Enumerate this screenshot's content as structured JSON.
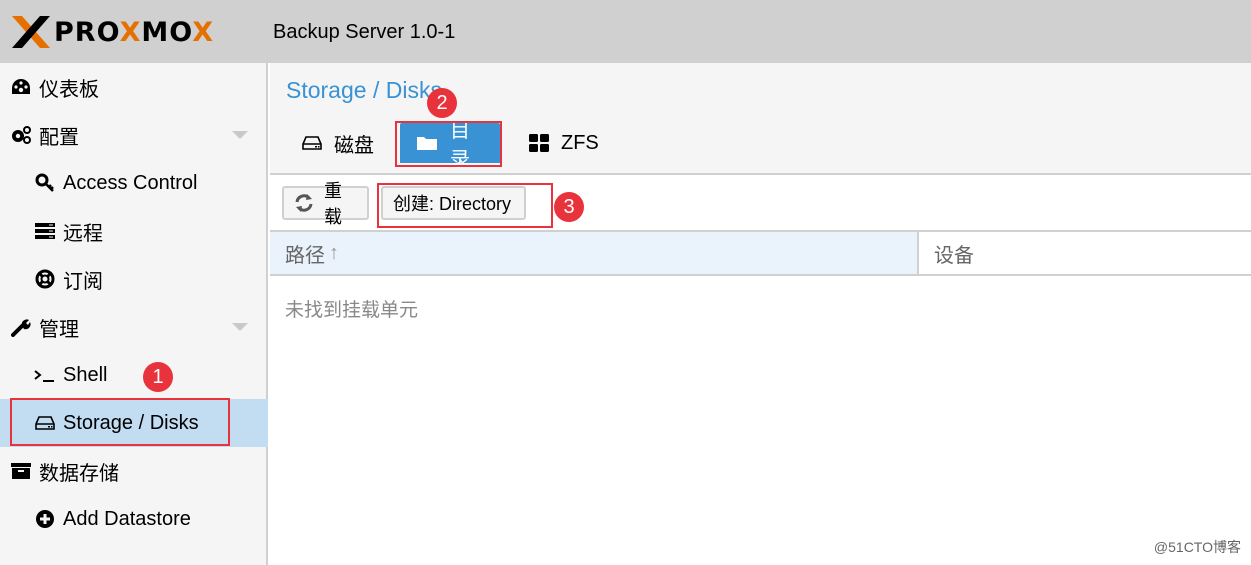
{
  "header": {
    "logo_text_parts": [
      "PRO",
      "X",
      "MO",
      "X"
    ],
    "product": "Backup Server 1.0-1"
  },
  "sidebar": {
    "items": [
      {
        "label": "仪表板",
        "icon": "dashboard-icon",
        "level": 1
      },
      {
        "label": "配置",
        "icon": "cogs-icon",
        "level": 1,
        "expandable": true
      },
      {
        "label": "Access Control",
        "icon": "key-icon",
        "level": 2
      },
      {
        "label": "远程",
        "icon": "server-icon",
        "level": 2
      },
      {
        "label": "订阅",
        "icon": "support-icon",
        "level": 2
      },
      {
        "label": "管理",
        "icon": "wrench-icon",
        "level": 1,
        "expandable": true
      },
      {
        "label": "Shell",
        "icon": "terminal-icon",
        "level": 2
      },
      {
        "label": "Storage / Disks",
        "icon": "hdd-icon",
        "level": 2,
        "selected": true
      },
      {
        "label": "数据存储",
        "icon": "archive-icon",
        "level": 1
      },
      {
        "label": "Add Datastore",
        "icon": "plus-circle-icon",
        "level": 2
      }
    ]
  },
  "main": {
    "title": "Storage / Disks",
    "tabs": [
      {
        "label": "磁盘",
        "icon": "hdd-icon"
      },
      {
        "label": "目录",
        "icon": "folder-icon",
        "active": true
      },
      {
        "label": "ZFS",
        "icon": "th-large-icon"
      }
    ],
    "toolbar": {
      "reload_label": "重载",
      "create_label": "创建: Directory"
    },
    "grid": {
      "columns": [
        {
          "label": "路径",
          "sort": "↑"
        },
        {
          "label": "设备"
        }
      ],
      "empty_text": "未找到挂载单元"
    }
  },
  "annotations": [
    "1",
    "2",
    "3"
  ],
  "watermark": "@51CTO博客",
  "colors": {
    "accent": "#3892d4",
    "selected_bg": "#c2dcf2",
    "annotation": "#e8323c",
    "logo_orange": "#e57000"
  }
}
